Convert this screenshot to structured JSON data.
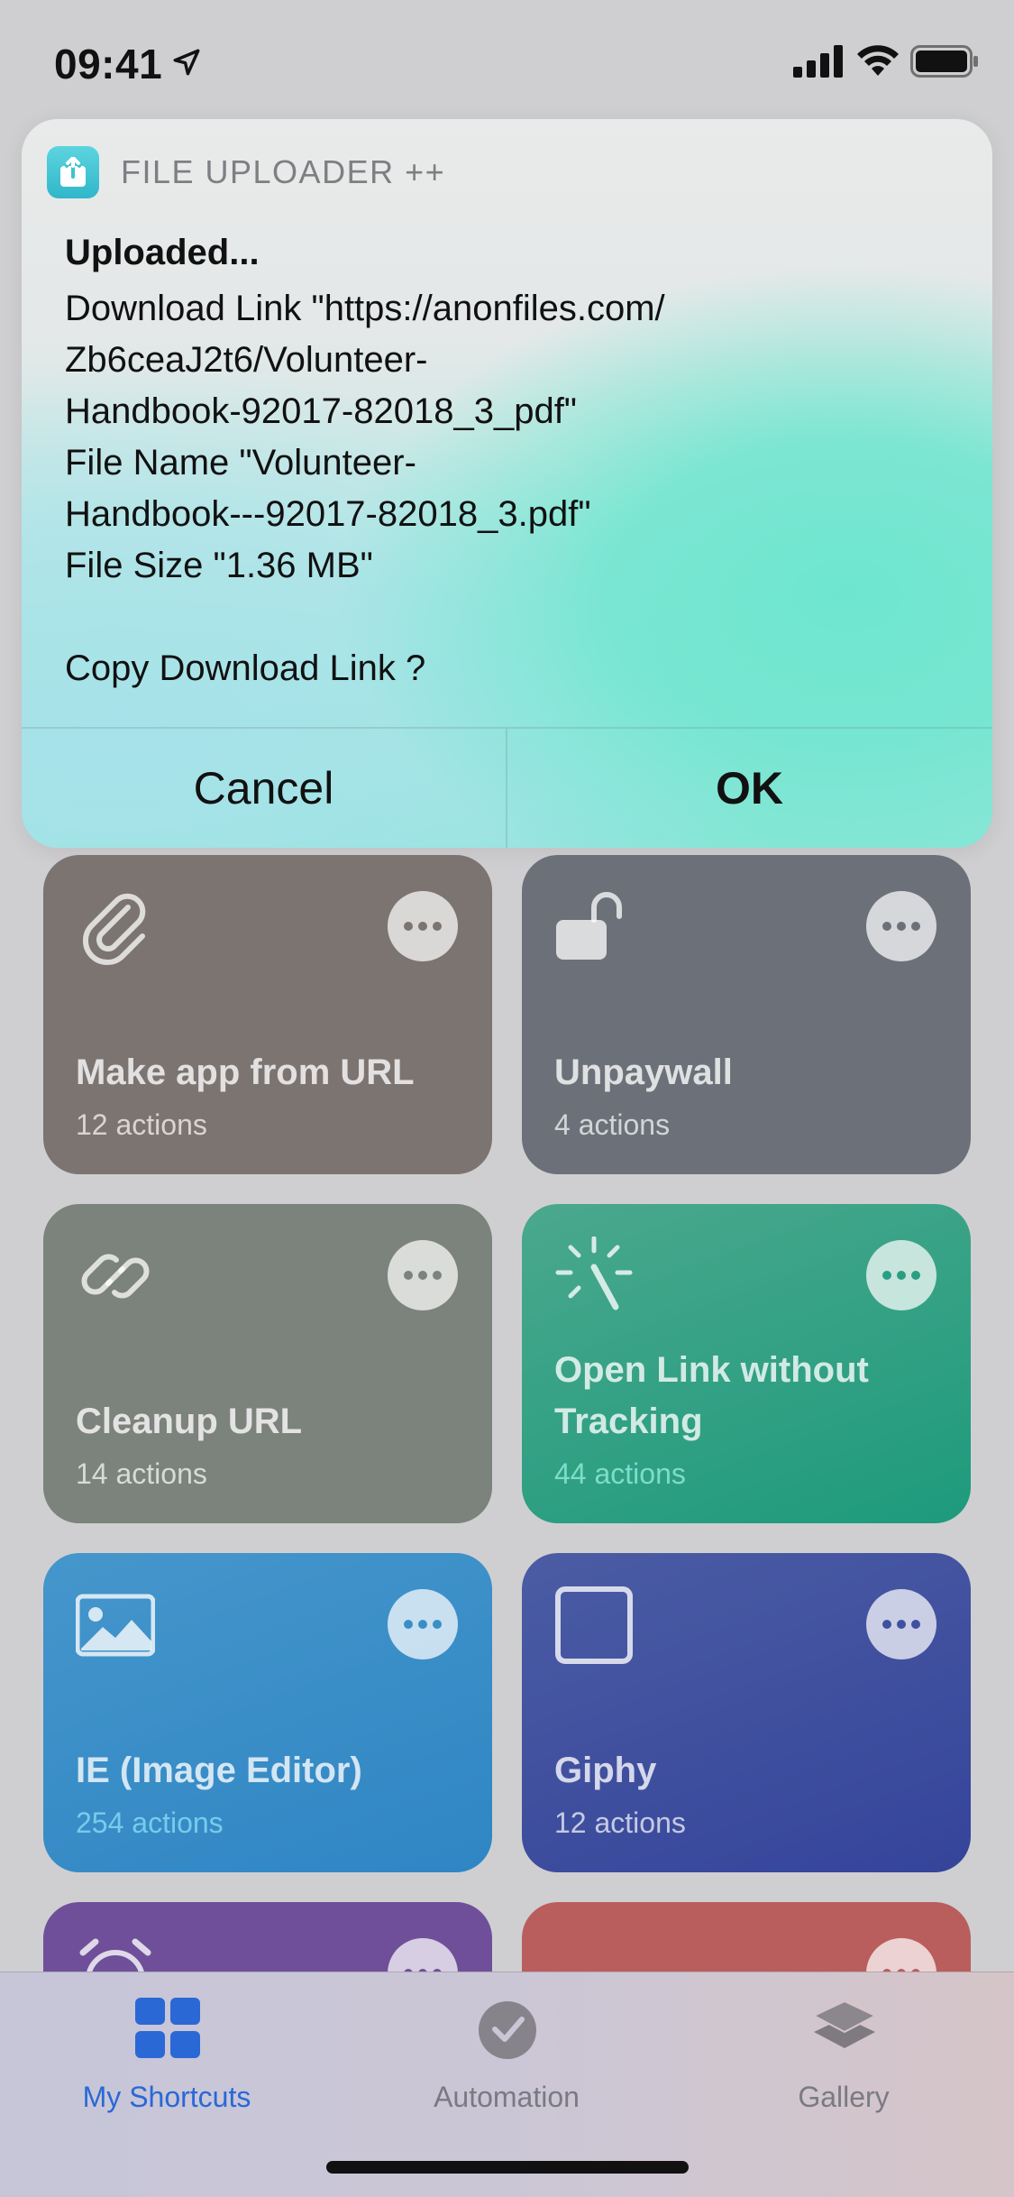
{
  "status_bar": {
    "time": "09:41"
  },
  "alert": {
    "app_name": "FILE UPLOADER ++",
    "title": "Uploaded...",
    "body": "Download Link \"https://anonfiles.com/\nZb6ceaJ2t6/Volunteer-\nHandbook-92017-82018_3_pdf\"\nFile Name \"Volunteer-\nHandbook---92017-82018_3.pdf\"\nFile Size \"1.36 MB\"\n\nCopy Download Link ?",
    "cancel_label": "Cancel",
    "ok_label": "OK"
  },
  "shortcuts": [
    {
      "title": "Make app from URL",
      "count": "12 actions",
      "icon": "paperclip-icon"
    },
    {
      "title": "Unpaywall",
      "count": "4 actions",
      "icon": "unlock-icon"
    },
    {
      "title": "Cleanup URL",
      "count": "14 actions",
      "icon": "link-icon"
    },
    {
      "title": "Open Link without Tracking",
      "count": "44 actions",
      "icon": "magic-wand-icon"
    },
    {
      "title": "IE (Image Editor)",
      "count": "254 actions",
      "icon": "image-icon"
    },
    {
      "title": "Giphy",
      "count": "12 actions",
      "icon": "square-icon"
    },
    {
      "title": "",
      "count": "",
      "icon": "alarm-icon"
    },
    {
      "title": "",
      "count": "",
      "icon": "play-icon"
    }
  ],
  "tab_bar": {
    "tabs": [
      {
        "label": "My Shortcuts"
      },
      {
        "label": "Automation"
      },
      {
        "label": "Gallery"
      }
    ]
  },
  "colors": {
    "accent": "#2a68d6",
    "alert_teal": "#6ee6cf"
  }
}
